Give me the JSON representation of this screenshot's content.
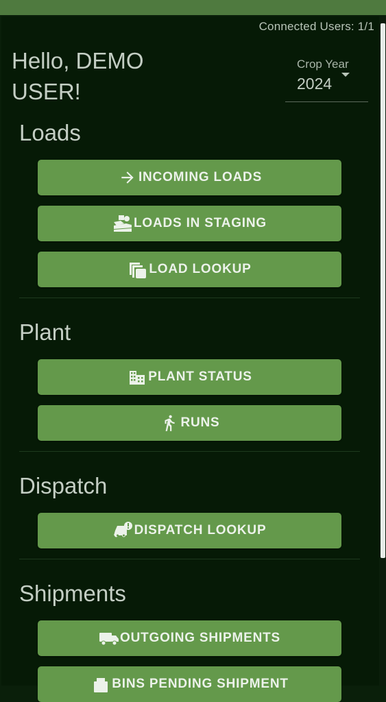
{
  "header": {
    "connected_users": "Connected Users: 1/1",
    "greeting": "Hello, DEMO USER!"
  },
  "crop_year": {
    "label": "Crop Year",
    "value": "2024"
  },
  "sections": {
    "loads": {
      "title": "Loads",
      "buttons": [
        {
          "label": "INCOMING LOADS",
          "icon": "arrow-right-icon"
        },
        {
          "label": "LOADS IN STAGING",
          "icon": "staging-icon"
        },
        {
          "label": "LOAD LOOKUP",
          "icon": "library-copy-icon"
        }
      ]
    },
    "plant": {
      "title": "Plant",
      "buttons": [
        {
          "label": "PLANT STATUS",
          "icon": "building-icon"
        },
        {
          "label": "RUNS",
          "icon": "running-person-icon"
        }
      ]
    },
    "dispatch": {
      "title": "Dispatch",
      "buttons": [
        {
          "label": "DISPATCH LOOKUP",
          "icon": "car-alert-icon"
        }
      ]
    },
    "shipments": {
      "title": "Shipments",
      "buttons": [
        {
          "label": "OUTGOING SHIPMENTS",
          "icon": "truck-icon"
        },
        {
          "label": "BINS PENDING SHIPMENT",
          "icon": "bins-icon"
        }
      ]
    }
  },
  "colors": {
    "background": "#061a06",
    "topbar": "#4f7a3f",
    "button": "#64994b",
    "button_text": "#ecf2ea",
    "title_text": "#c4cec4"
  }
}
